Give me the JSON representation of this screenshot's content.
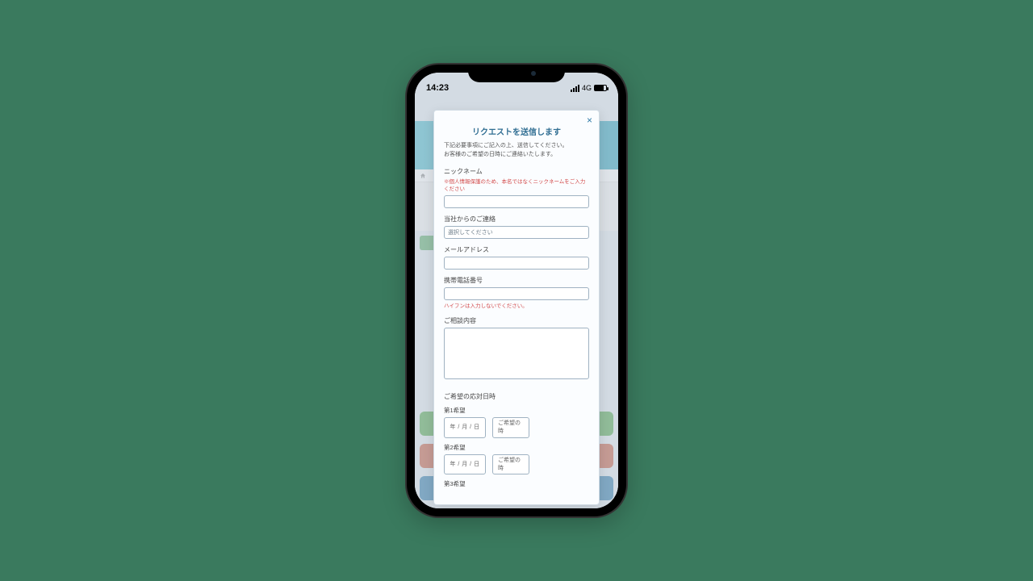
{
  "status": {
    "time": "14:23",
    "network": "4G"
  },
  "modal": {
    "title": "リクエストを送信します",
    "lead1": "下記必要事項にご記入の上、送信してください。",
    "lead2": "お客様のご希望の日時にご連絡いたします。",
    "nickname_label": "ニックネーム",
    "nickname_note": "※個人情報保護のため、本名ではなくニックネームをご入力ください",
    "contact_label": "当社からのご連絡",
    "contact_placeholder": "選択してください",
    "email_label": "メールアドレス",
    "phone_label": "携帯電話番号",
    "phone_note": "ハイフンは入力しないでください。",
    "content_label": "ご相談内容",
    "datetime_section": "ご希望の応対日時",
    "pref1": "第1希望",
    "pref2": "第2希望",
    "pref3": "第3希望",
    "date_placeholder": "年 / 月 / 日",
    "time_placeholder": "ご希望の時"
  }
}
